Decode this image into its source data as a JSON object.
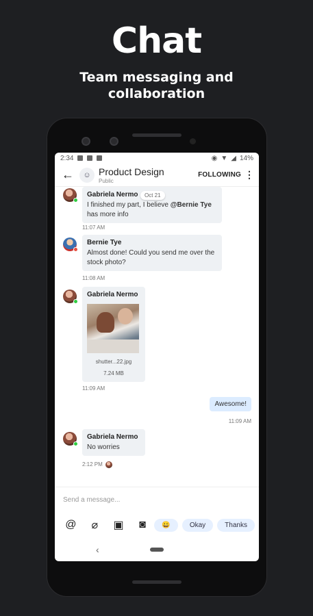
{
  "promo": {
    "title": "Chat",
    "subtitle_line1": "Team messaging and",
    "subtitle_line2": "collaboration"
  },
  "status_bar": {
    "time": "2:34",
    "battery": "14%"
  },
  "header": {
    "back_icon": "arrow-left-icon",
    "group_icon": "group-icon",
    "title": "Product Design",
    "subtitle": "Public",
    "following": "FOLLOWING"
  },
  "date_chip": "Oct 21",
  "messages": [
    {
      "sender": "Gabriela Nermo",
      "text_before": "I finished my part, I believe ",
      "mention": "@Bernie Tye",
      "text_after": " has more info",
      "time": "11:07 AM"
    },
    {
      "sender": "Bernie Tye",
      "text": "Almost done! Could you send me over the stock photo?",
      "time": "11:08 AM"
    },
    {
      "sender": "Gabriela Nermo",
      "file_name": "shutter...22.jpg",
      "file_size": "7.24 MB",
      "time": "11:09 AM"
    },
    {
      "text": "Awesome!",
      "time": "11:09 AM",
      "mine": true
    },
    {
      "sender": "Gabriela Nermo",
      "text": "No worries",
      "time": "2:12 PM"
    }
  ],
  "composer": {
    "placeholder": "Send a message...",
    "tools": [
      "at-sign-icon",
      "paperclip-icon",
      "image-icon",
      "camera-icon"
    ],
    "quick_replies": [
      "😀",
      "Okay",
      "Thanks"
    ]
  },
  "colors": {
    "background": "#1e1f22",
    "online": "#2ecc40",
    "my_bubble": "#dcecff",
    "their_bubble": "#eef1f4"
  }
}
